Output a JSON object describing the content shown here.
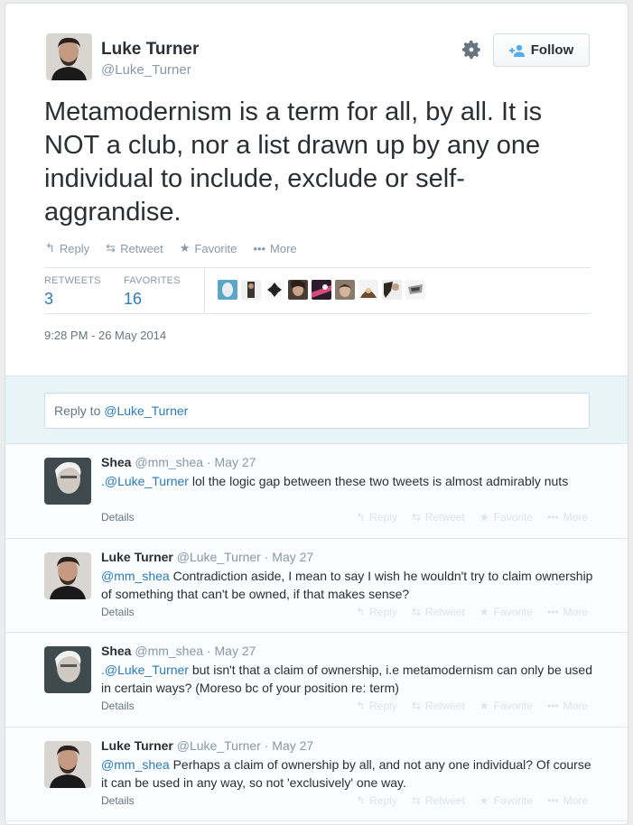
{
  "tweet": {
    "author_name": "Luke Turner",
    "author_handle": "@Luke_Turner",
    "follow_label": "Follow",
    "text": "Metamodernism is a term for all, by all. It is NOT a club, nor a list drawn up by any one individual to include, exclude or self-aggrandise.",
    "actions": {
      "reply": "Reply",
      "retweet": "Retweet",
      "favorite": "Favorite",
      "more": "More"
    },
    "stats": {
      "retweets_label": "RETWEETS",
      "retweets_value": "3",
      "favorites_label": "FAVORITES",
      "favorites_value": "16"
    },
    "favoriter_avatars": [
      "user-avatar-1",
      "user-avatar-2",
      "user-avatar-3",
      "user-avatar-4",
      "user-avatar-5",
      "user-avatar-6",
      "user-avatar-7",
      "user-avatar-8",
      "user-avatar-9"
    ],
    "timestamp": "9:28 PM - 26 May 2014"
  },
  "reply_box": {
    "prefix": "Reply to ",
    "mention": "@Luke_Turner"
  },
  "replies": [
    {
      "name": "Shea",
      "handle": "@mm_shea",
      "date": "May 27",
      "mention": ".@Luke_Turner",
      "text": " lol the logic gap between these two tweets is almost admirably nuts",
      "details": "Details"
    },
    {
      "name": "Luke Turner",
      "handle": "@Luke_Turner",
      "date": "May 27",
      "mention": "@mm_shea",
      "text": " Contradiction aside, I mean to say I wish he wouldn't try to claim ownership of something that can't be owned, if that makes sense?",
      "details": "Details"
    },
    {
      "name": "Shea",
      "handle": "@mm_shea",
      "date": "May 27",
      "mention": ".@Luke_Turner",
      "text": " but isn't that a claim of ownership, i.e metamodernism can only be used in certain ways? (Moreso bc of your position re: term)",
      "details": "Details"
    },
    {
      "name": "Luke Turner",
      "handle": "@Luke_Turner",
      "date": "May 27",
      "mention": "@mm_shea",
      "text": " Perhaps a claim of ownership by all, and not any one individual? Of course it can be used in any way, so not 'exclusively' one way.",
      "details": "Details"
    }
  ],
  "reply_actions": {
    "reply": "Reply",
    "retweet": "Retweet",
    "favorite": "Favorite",
    "more": "More"
  },
  "colors": {
    "link": "#2b7bb9",
    "follow_icon": "#55acee",
    "muted": "#8899a6"
  }
}
